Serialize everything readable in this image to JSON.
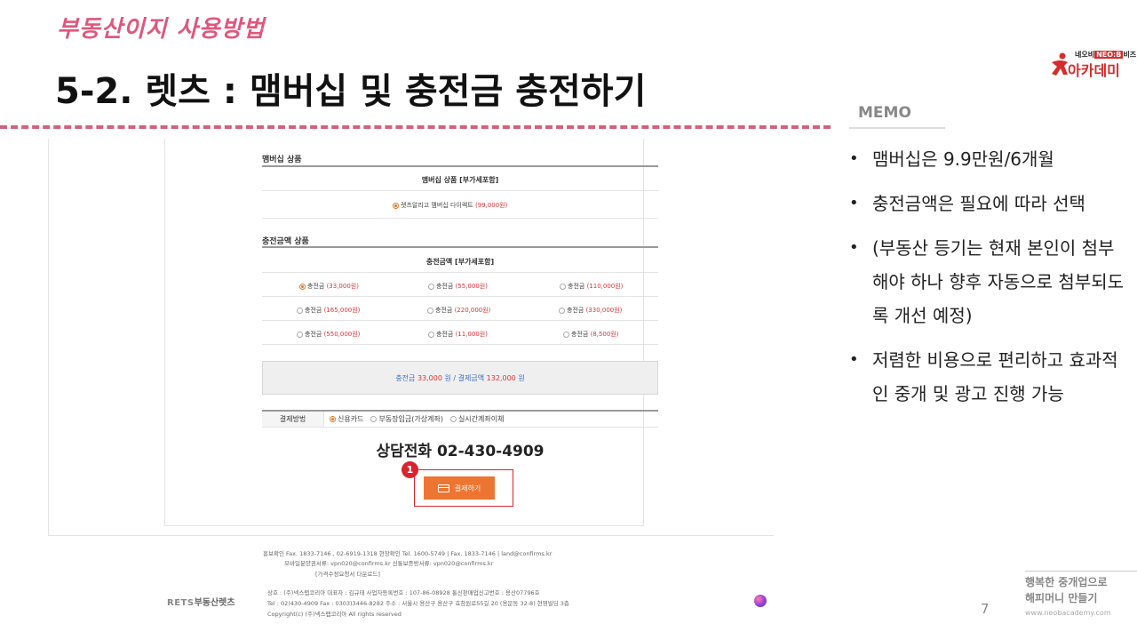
{
  "slide": {
    "subtitle": "부동산이지 사용방법",
    "title": "5-2. 렛츠 : 맴버십 및 충전금 충전하기",
    "page_number": "7"
  },
  "logo": {
    "top_line_prefix": "네오비",
    "top_line_badge": "NEO:B",
    "top_line_suffix": "비즈",
    "main": "아카데미"
  },
  "memo": {
    "label": "MEMO",
    "items": [
      "맴버십은 9.9만원/6개월",
      "충전금액은 필요에 따라 선택",
      "(부동산 등기는 현재 본인이 첨부해야 하나 향후 자동으로 첨부되도록 개선 예정)",
      "저렴한 비용으로 편리하고 효과적인 중개 및 광고 진행 가능"
    ]
  },
  "membership": {
    "section_title": "맴버십 상품",
    "sub_head": "맴버십 상품 [부가세포함]",
    "option_label": "렛츠알리고 맴버십 다이렉트",
    "option_price": "(99,000원)"
  },
  "charge": {
    "section_title": "충전금액 상품",
    "sub_head": "충전금액 [부가세포함]",
    "options": [
      {
        "label": "충전금",
        "price": "(33,000원)"
      },
      {
        "label": "충전금",
        "price": "(55,000원)"
      },
      {
        "label": "충전금",
        "price": "(110,000원)"
      },
      {
        "label": "충전금",
        "price": "(165,000원)"
      },
      {
        "label": "충전금",
        "price": "(220,000원)"
      },
      {
        "label": "충전금",
        "price": "(330,000원)"
      },
      {
        "label": "충전금",
        "price": "(550,000원)"
      },
      {
        "label": "충전금",
        "price": "(11,000원)"
      },
      {
        "label": "충전금",
        "price": "(8,500원)"
      }
    ],
    "selected_index": 0
  },
  "total": {
    "charge_label": "충전금",
    "charge_value": "33,000",
    "unit": "원",
    "separator": "/",
    "pay_label": "결제금액",
    "pay_value": "132,000"
  },
  "payment": {
    "label": "결제방법",
    "methods": [
      "신용카드",
      "부동장입금(가상계좌)",
      "실시간계좌이체"
    ],
    "selected_index": 0
  },
  "phone": "상담전화 02-430-4909",
  "badge": "1",
  "pay_button": "결제하기",
  "footer": {
    "line1": "홍보확인 Fax. 1833-7146 , 02-6919-1318   현장확인 Tel. 1600-5749 | Fax. 1833-7146 | land@confirms.kr",
    "line2": "모바일분양권서류: vpn020@confirms.kr     신통보증방서류: vpn020@confirms.kr",
    "line3": "[가격수정요청서 다운로드]",
    "line4": "상호 : (주)넥스랩코리아    대표자 : 김규태     사업자등록번호 : 107-86-08928     통신판매업신고번호 : 용산07796호",
    "line5": "Tel : 02)430-4909     Fax : 0303)3446-8282     주소 : 서울시 용산구 용산구 효창원로55길 20 (용문동 32-8) 현영빌딩 3층",
    "line6": "Copyright(c) (주)넥스랩코리아 All rights reserved",
    "logo_a": "RETS",
    "logo_b": "부동산렛츠"
  },
  "brand": {
    "slogan_1": "행복한 중개업으로",
    "slogan_2": "해피머니 만들기",
    "url": "www.neobacademy.com"
  },
  "colors": {
    "accent_pink": "#e0577c",
    "highlight_red": "#d9232d",
    "button_orange": "#ee7531"
  }
}
